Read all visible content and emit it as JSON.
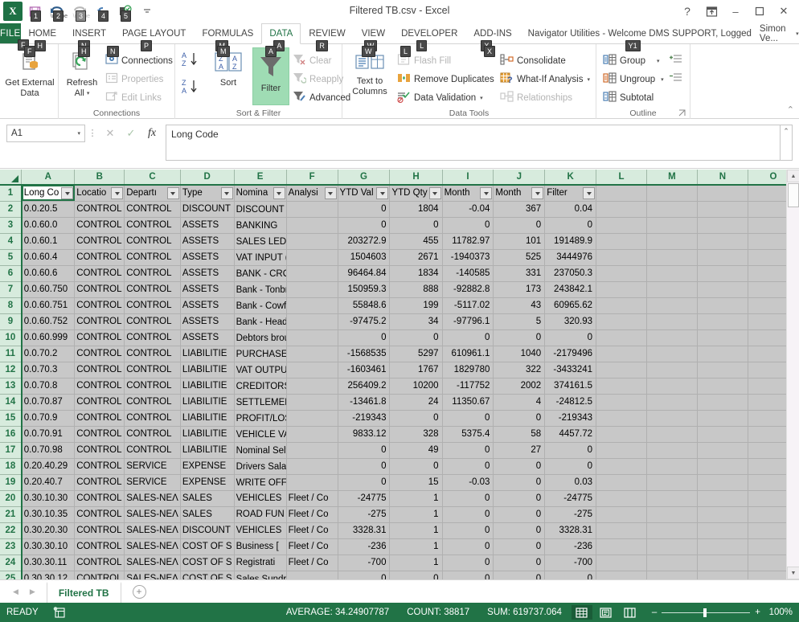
{
  "window": {
    "title": "Filtered TB.csv - Excel",
    "help_icon": "?",
    "ribbon_display_icon": "ribbon-display-options",
    "minimize_icon": "–",
    "restore_icon": "❑",
    "close_icon": "✕"
  },
  "quick_access": [
    {
      "name": "excel-logo",
      "label": "X",
      "keytip": ""
    },
    {
      "name": "save-button",
      "label": "",
      "keytip": "1"
    },
    {
      "name": "undo-button",
      "label": "",
      "keytip": "2"
    },
    {
      "name": "redo-button",
      "label": "",
      "keytip": "3"
    },
    {
      "name": "refresh-button",
      "label": "",
      "keytip": "4"
    },
    {
      "name": "spelling-check-button",
      "label": "",
      "keytip": "5"
    },
    {
      "name": "customize-qat-button",
      "label": "",
      "keytip": ""
    }
  ],
  "tabs": [
    {
      "label": "FILE",
      "keytip": "F",
      "active": false
    },
    {
      "label": "HOME",
      "keytip": "H",
      "active": false
    },
    {
      "label": "INSERT",
      "keytip": "N",
      "active": false
    },
    {
      "label": "PAGE LAYOUT",
      "keytip": "P",
      "active": false
    },
    {
      "label": "FORMULAS",
      "keytip": "M",
      "active": false
    },
    {
      "label": "DATA",
      "keytip": "A",
      "active": true
    },
    {
      "label": "REVIEW",
      "keytip": "R",
      "active": false
    },
    {
      "label": "VIEW",
      "keytip": "W",
      "active": false
    },
    {
      "label": "DEVELOPER",
      "keytip": "L",
      "active": false
    },
    {
      "label": "ADD-INS",
      "keytip": "X",
      "active": false
    },
    {
      "label": "Navigator Utilities - Welcome DMS SUPPORT, Logged",
      "keytip": "Y1",
      "active": false
    }
  ],
  "user": {
    "name": "Simon Ve...",
    "caret": "▾"
  },
  "ribbon": {
    "groups": [
      {
        "name": "get-external-data",
        "label": ""
      },
      {
        "name": "connections",
        "label": "Connections"
      },
      {
        "name": "sort-filter",
        "label": "Sort & Filter"
      },
      {
        "name": "data-tools",
        "label": "Data Tools"
      },
      {
        "name": "outline",
        "label": "Outline"
      }
    ],
    "get_external_data": {
      "line1": "Get External",
      "line2": "Data",
      "caret": "▾"
    },
    "refresh_all": {
      "line1": "Refresh",
      "line2": "All",
      "caret": "▾"
    },
    "connections_label": "Connections",
    "properties_label": "Properties",
    "edit_links_label": "Edit Links",
    "sort_az_label": "",
    "sort_za_label": "",
    "sort_label": "Sort",
    "filter_label": "Filter",
    "clear_label": "Clear",
    "reapply_label": "Reapply",
    "advanced_label": "Advanced",
    "text_to_columns": {
      "line1": "Text to",
      "line2": "Columns"
    },
    "flash_fill_label": "Flash Fill",
    "remove_duplicates_label": "Remove Duplicates",
    "data_validation_label": "Data Validation",
    "consolidate_label": "Consolidate",
    "what_if_label": "What-If Analysis",
    "relationships_label": "Relationships",
    "group_label": "Group",
    "ungroup_label": "Ungroup",
    "subtotal_label": "Subtotal",
    "collapse_icon": "⌃"
  },
  "formula_bar": {
    "name_box": "A1",
    "name_box_caret": "▾",
    "cancel_icon": "✕",
    "enter_icon": "✓",
    "function_icon": "fx",
    "value": "Long Code",
    "expand_icon": "⌃"
  },
  "grid": {
    "columns": [
      "A",
      "B",
      "C",
      "D",
      "E",
      "F",
      "G",
      "H",
      "I",
      "J",
      "K",
      "L",
      "M",
      "N",
      "O"
    ],
    "active_cell": "A1",
    "headers": [
      "Long Co",
      "Locatio",
      "Departı",
      "Type",
      "Nomina",
      "Analysi",
      "YTD Val",
      "YTD Qty",
      "Month",
      "Month",
      "Filter"
    ],
    "rows": [
      {
        "n": 1,
        "cells": [
          "Long Co",
          "Locatio",
          "Departı",
          "Type",
          "Nomina",
          "Analysi",
          "YTD Val",
          "YTD Qty",
          "Month",
          "Month",
          "Filter"
        ]
      },
      {
        "n": 2,
        "cells": [
          "0.0.20.5",
          "CONTROL",
          "CONTROL",
          "DISCOUNT",
          "DISCOUNT",
          "",
          "0",
          "1804",
          "-0.04",
          "367",
          "0.04"
        ]
      },
      {
        "n": 3,
        "cells": [
          "0.0.60.0",
          "CONTROL",
          "CONTROL",
          "ASSETS",
          "BANKING",
          "",
          "0",
          "0",
          "0",
          "0",
          "0"
        ]
      },
      {
        "n": 4,
        "cells": [
          "0.0.60.1",
          "CONTROL",
          "CONTROL",
          "ASSETS",
          "SALES LEDGER CONTI",
          "",
          "203272.9",
          "455",
          "11782.97",
          "101",
          "191489.9"
        ]
      },
      {
        "n": 5,
        "cells": [
          "0.0.60.4",
          "CONTROL",
          "CONTROL",
          "ASSETS",
          "VAT INPUT (PURCHA",
          "",
          "1504603",
          "2671",
          "-1940373",
          "525",
          "3444976"
        ]
      },
      {
        "n": 6,
        "cells": [
          "0.0.60.6",
          "CONTROL",
          "CONTROL",
          "ASSETS",
          "BANK - CROYDON",
          "",
          "96464.84",
          "1834",
          "-140585",
          "331",
          "237050.3"
        ]
      },
      {
        "n": 7,
        "cells": [
          "0.0.60.750",
          "CONTROL",
          "CONTROL",
          "ASSETS",
          "Bank - Tonbridge",
          "",
          "150959.3",
          "888",
          "-92882.8",
          "173",
          "243842.1"
        ]
      },
      {
        "n": 8,
        "cells": [
          "0.0.60.751",
          "CONTROL",
          "CONTROL",
          "ASSETS",
          "Bank - Cowfold",
          "",
          "55848.6",
          "199",
          "-5117.02",
          "43",
          "60965.62"
        ]
      },
      {
        "n": 9,
        "cells": [
          "0.0.60.752",
          "CONTROL",
          "CONTROL",
          "ASSETS",
          "Bank - Head Office",
          "",
          "-97475.2",
          "34",
          "-97796.1",
          "5",
          "320.93"
        ]
      },
      {
        "n": 10,
        "cells": [
          "0.0.60.999",
          "CONTROL",
          "CONTROL",
          "ASSETS",
          "Debtors brought forv",
          "",
          "0",
          "0",
          "0",
          "0",
          "0"
        ]
      },
      {
        "n": 11,
        "cells": [
          "0.0.70.2",
          "CONTROL",
          "CONTROL",
          "LIABILITIE",
          "PURCHASE LEDGER C",
          "",
          "-1568535",
          "5297",
          "610961.1",
          "1040",
          "-2179496"
        ]
      },
      {
        "n": 12,
        "cells": [
          "0.0.70.3",
          "CONTROL",
          "CONTROL",
          "LIABILITIE",
          "VAT OUTPUT (SALES)",
          "",
          "-1603461",
          "1767",
          "1829780",
          "322",
          "-3433241"
        ]
      },
      {
        "n": 13,
        "cells": [
          "0.0.70.8",
          "CONTROL",
          "CONTROL",
          "LIABILITIE",
          "CREDITORS SUSPENS",
          "",
          "256409.2",
          "10200",
          "-117752",
          "2002",
          "374161.5"
        ]
      },
      {
        "n": 14,
        "cells": [
          "0.0.70.87",
          "CONTROL",
          "CONTROL",
          "LIABILITIE",
          "SETTLEMENT SUSPEN",
          "",
          "-13461.8",
          "24",
          "11350.67",
          "4",
          "-24812.5"
        ]
      },
      {
        "n": 15,
        "cells": [
          "0.0.70.9",
          "CONTROL",
          "CONTROL",
          "LIABILITIE",
          "PROFIT/LOSS ACCOU",
          "",
          "-219343",
          "0",
          "0",
          "0",
          "-219343"
        ]
      },
      {
        "n": 16,
        "cells": [
          "0.0.70.91",
          "CONTROL",
          "CONTROL",
          "LIABILITIE",
          "VEHICLE VAT DEPOSI",
          "",
          "9833.12",
          "328",
          "5375.4",
          "58",
          "4457.72"
        ]
      },
      {
        "n": 17,
        "cells": [
          "0.0.70.98",
          "CONTROL",
          "CONTROL",
          "LIABILITIE",
          "Nominal Self Correc",
          "",
          "0",
          "49",
          "0",
          "27",
          "0"
        ]
      },
      {
        "n": 18,
        "cells": [
          "0.20.40.29",
          "CONTROL",
          "SERVICE",
          "EXPENSE",
          "Drivers Salaries",
          "",
          "0",
          "0",
          "0",
          "0",
          "0"
        ]
      },
      {
        "n": 19,
        "cells": [
          "0.20.40.7",
          "CONTROL",
          "SERVICE",
          "EXPENSE",
          "WRITE OFF",
          "",
          "0",
          "15",
          "-0.03",
          "0",
          "0.03"
        ]
      },
      {
        "n": 20,
        "cells": [
          "0.30.10.30",
          "CONTROL",
          "SALES-NEɅ",
          "SALES",
          "VEHICLES",
          "Fleet / Co",
          "-24775",
          "1",
          "0",
          "0",
          "-24775"
        ]
      },
      {
        "n": 21,
        "cells": [
          "0.30.10.35",
          "CONTROL",
          "SALES-NEɅ",
          "SALES",
          "ROAD FUN",
          "Fleet / Co",
          "-275",
          "1",
          "0",
          "0",
          "-275"
        ]
      },
      {
        "n": 22,
        "cells": [
          "0.30.20.30",
          "CONTROL",
          "SALES-NEɅ",
          "DISCOUNT",
          "VEHICLES",
          "Fleet / Co",
          "3328.31",
          "1",
          "0",
          "0",
          "3328.31"
        ]
      },
      {
        "n": 23,
        "cells": [
          "0.30.30.10",
          "CONTROL",
          "SALES-NEɅ",
          "COST OF S",
          "Business [",
          "Fleet / Co",
          "-236",
          "1",
          "0",
          "0",
          "-236"
        ]
      },
      {
        "n": 24,
        "cells": [
          "0.30.30.11",
          "CONTROL",
          "SALES-NEɅ",
          "COST OF S",
          "Registrati",
          "Fleet / Co",
          "-700",
          "1",
          "0",
          "0",
          "-700"
        ]
      },
      {
        "n": 25,
        "cells": [
          "0.30.30.12",
          "CONTROL",
          "SALES-NEɅ",
          "COST OF S",
          "Sales Sundry Income",
          "",
          "0",
          "0",
          "0",
          "0",
          "0"
        ]
      }
    ]
  },
  "sheet_tabs": {
    "prev_icon": "◀",
    "next_icon": "▶",
    "tabs": [
      "Filtered TB"
    ],
    "add_icon": "+"
  },
  "status_bar": {
    "mode": "READY",
    "macro_icon": "record-macro-icon",
    "average_label": "AVERAGE: 34.24907787",
    "count_label": "COUNT: 38817",
    "sum_label": "SUM: 619737.064",
    "view_normal": "normal-view-icon",
    "view_page_layout": "page-layout-view-icon",
    "view_page_break": "page-break-preview-icon",
    "zoom_out": "–",
    "zoom_in": "+",
    "zoom_level": "100%"
  },
  "colors": {
    "accent_green": "#217346",
    "header_green": "#d7ebdd",
    "filter_highlight": "#9fdcb4",
    "selection_gray": "#c8c8c8"
  }
}
